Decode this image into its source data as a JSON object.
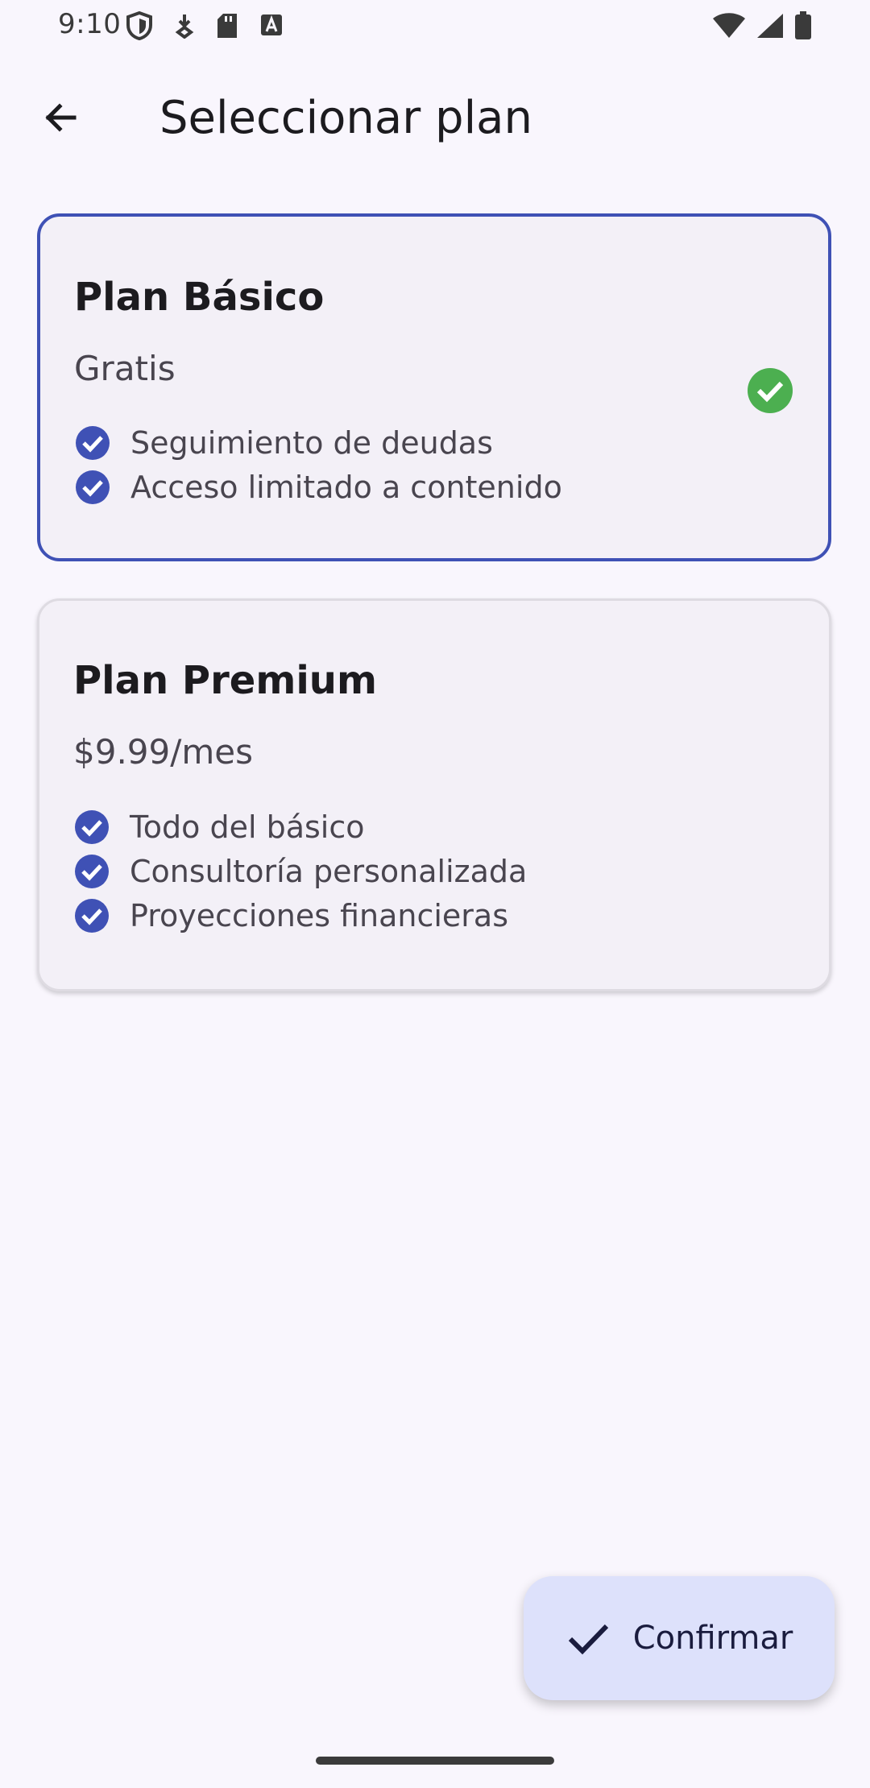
{
  "status_bar": {
    "time": "9:10",
    "left_icons": [
      "shield-icon",
      "data-saver-icon",
      "sd-card-icon",
      "translate-icon"
    ],
    "right_icons": [
      "wifi-icon",
      "signal-icon",
      "battery-icon"
    ]
  },
  "app_bar": {
    "back_icon": "arrow-back-icon",
    "title": "Seleccionar plan"
  },
  "plans": [
    {
      "name": "Plan Básico",
      "price": "Gratis",
      "selected": true,
      "features": [
        "Seguimiento de deudas",
        "Acceso limitado a contenido"
      ]
    },
    {
      "name": "Plan Premium",
      "price": "$9.99/mes",
      "selected": false,
      "features": [
        "Todo del básico",
        "Consultoría personalizada",
        "Proyecciones financieras"
      ]
    }
  ],
  "fab": {
    "icon": "check-icon",
    "label": "Confirmar"
  },
  "colors": {
    "background": "#f9f6fd",
    "card": "#f3f0f7",
    "accent": "#3f51b5",
    "selected_check": "#4caf50",
    "fab_bg": "#dde1fb"
  }
}
